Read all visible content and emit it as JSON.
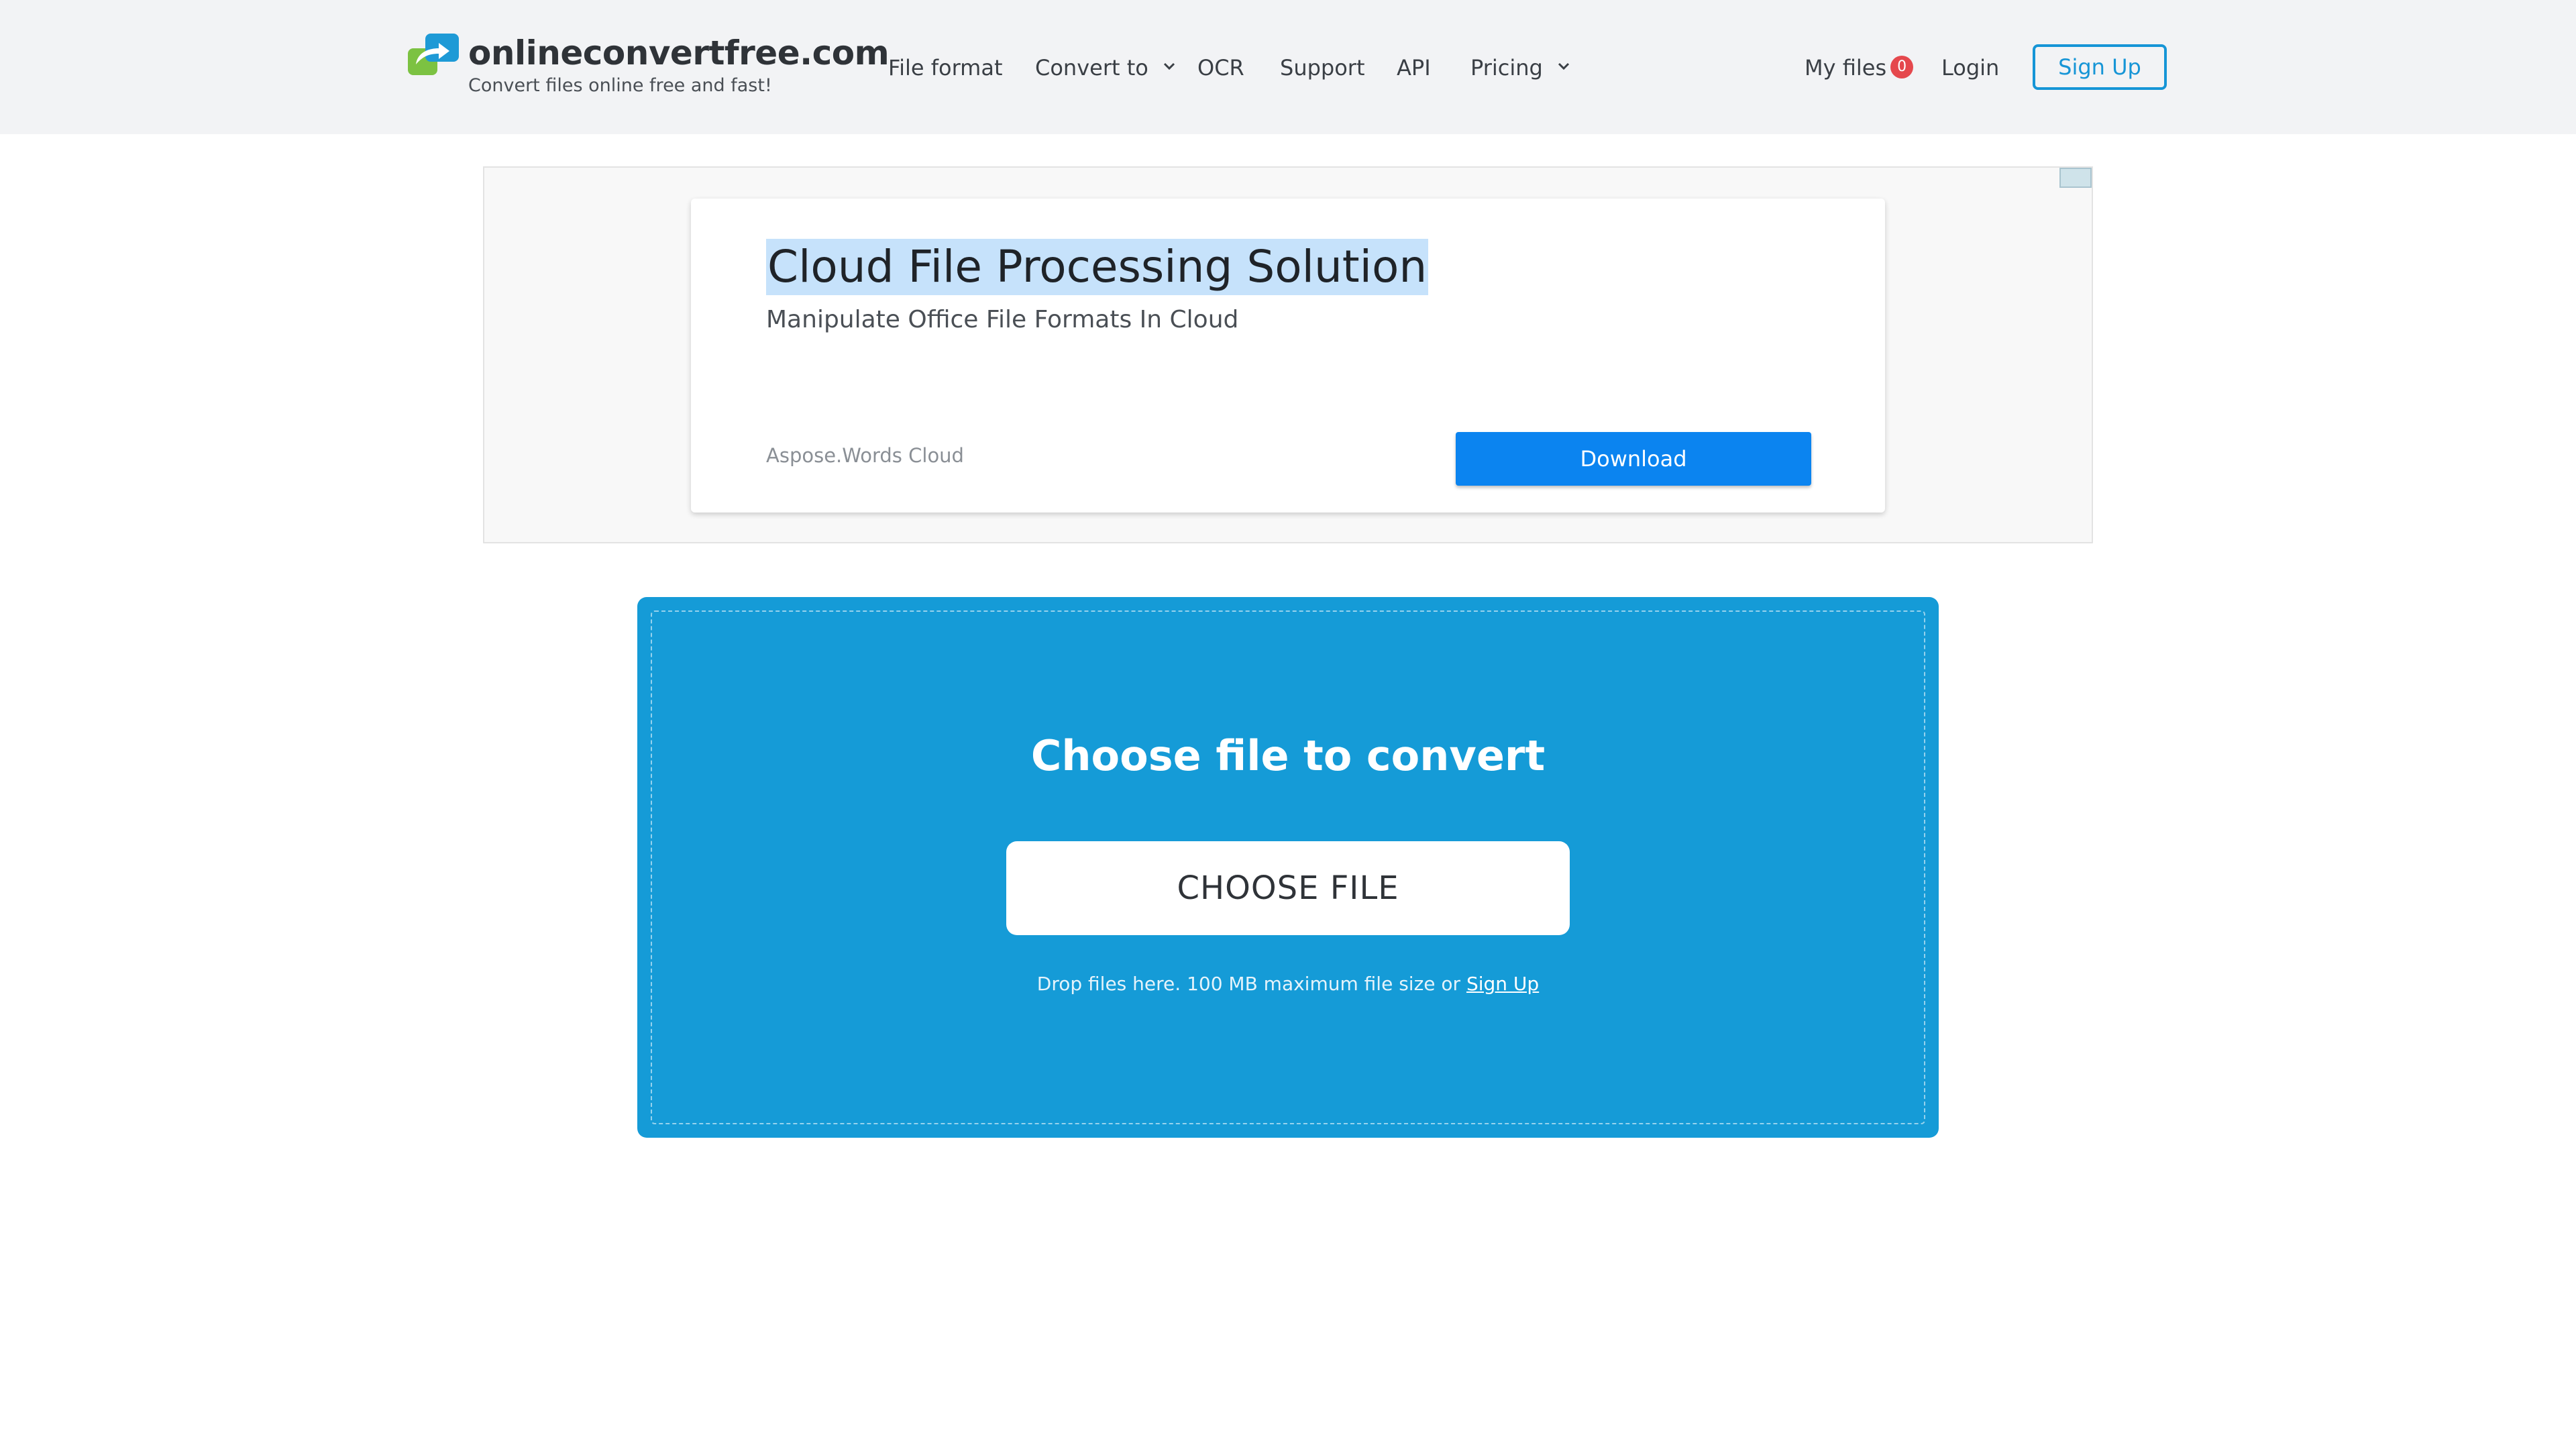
{
  "brand": {
    "title": "onlineconvertfree.com",
    "tagline": "Convert files online free and fast!"
  },
  "nav": {
    "file_format": "File format",
    "convert_to": "Convert to",
    "ocr": "OCR",
    "support": "Support",
    "api": "API",
    "pricing": "Pricing",
    "my_files": "My files",
    "my_files_count": "0",
    "login": "Login",
    "signup": "Sign Up"
  },
  "ad": {
    "title": "Cloud File Processing Solution",
    "subtitle": "Manipulate Office File Formats In Cloud",
    "advertiser": "Aspose.Words Cloud",
    "cta": "Download"
  },
  "upload": {
    "title": "Choose file to convert",
    "button": "CHOOSE FILE",
    "hint": "Drop files here. 100 MB maximum file size or",
    "hint_link": "Sign Up"
  },
  "colors": {
    "header_bg": "#f2f3f5",
    "accent": "#1695d6",
    "upload_bg": "#159bd7",
    "ad_cta": "#0b84f0",
    "badge": "#e5484d"
  }
}
